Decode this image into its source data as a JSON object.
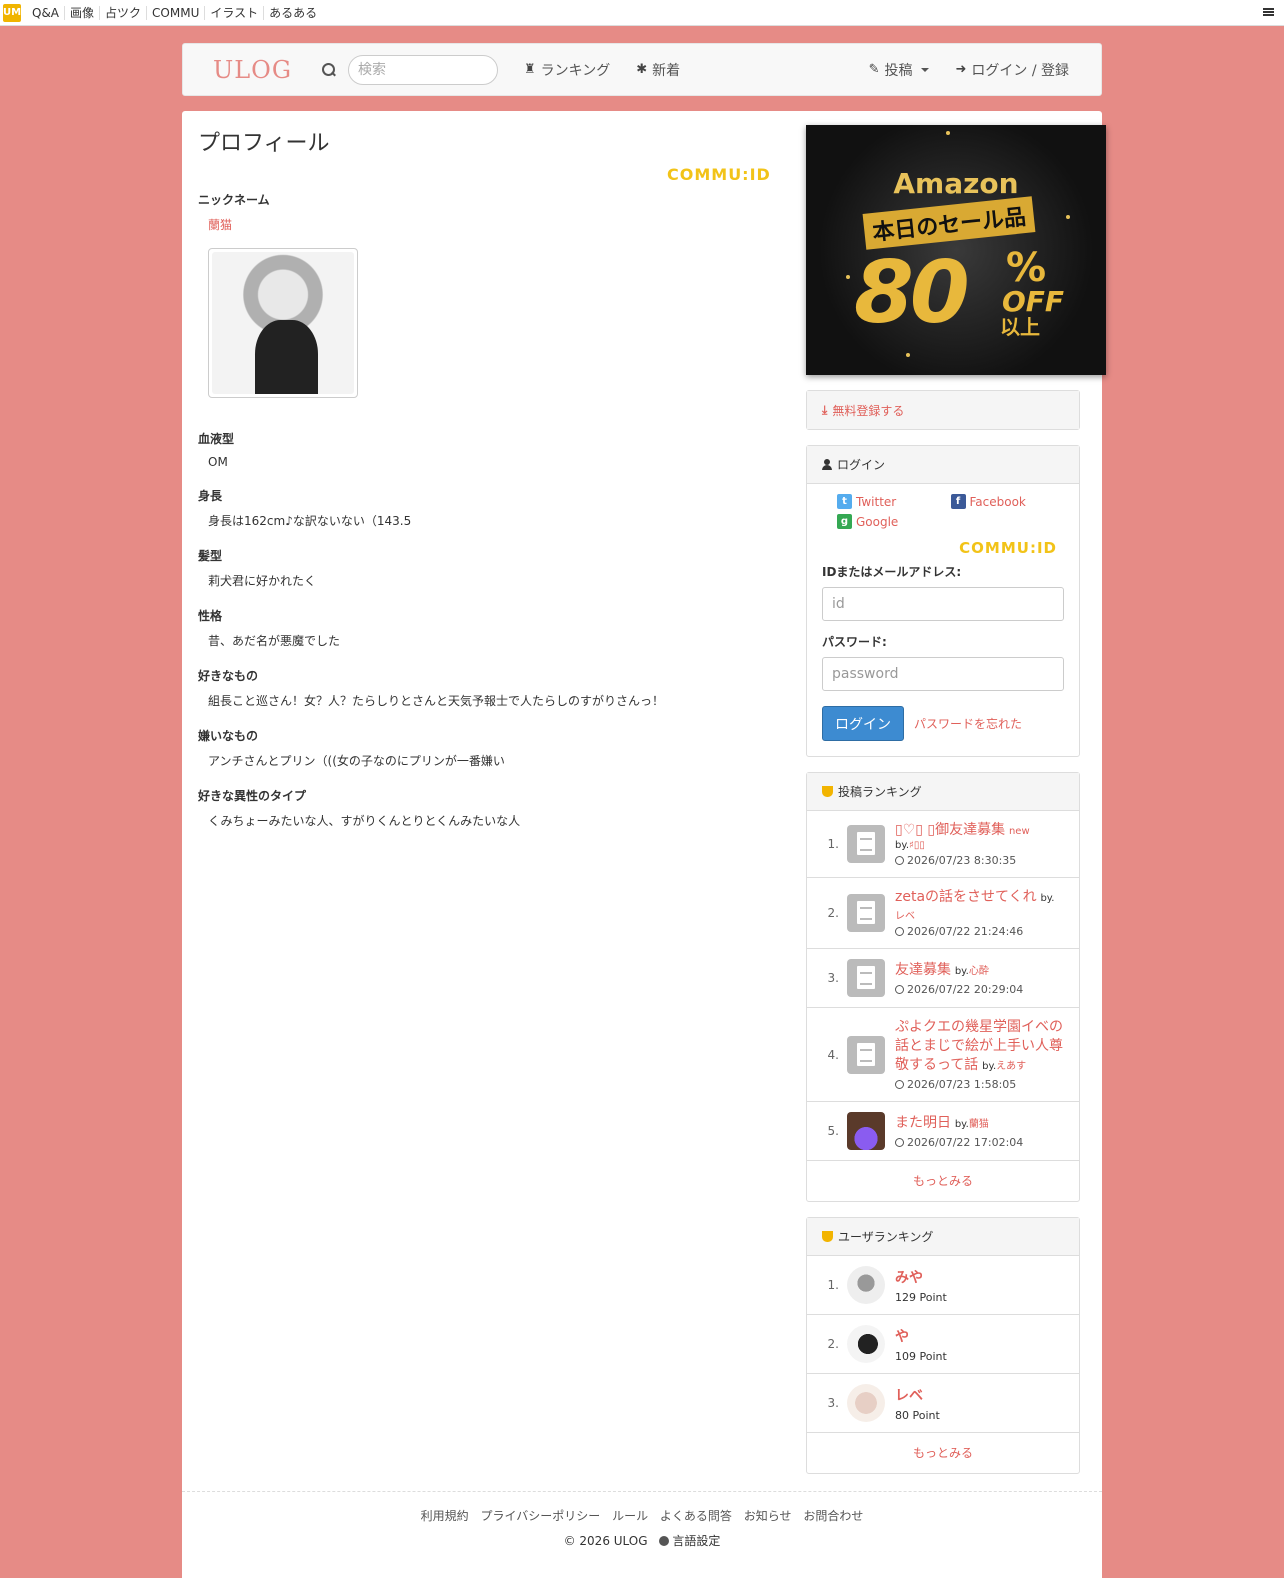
{
  "topbar": {
    "logo_text": "UM",
    "links": [
      "Q&A",
      "画像",
      "占ツク",
      "COMMU",
      "イラスト",
      "あるある"
    ]
  },
  "header": {
    "brand": "ULOG",
    "search_placeholder": "検索",
    "nav": {
      "ranking": "ランキング",
      "new": "新着",
      "post": "投稿",
      "login": "ログイン / 登録"
    }
  },
  "profile": {
    "title": "プロフィール",
    "commu_id": "COMMU:ID",
    "nickname_label": "ニックネーム",
    "nickname": "蘭猫",
    "fields": [
      {
        "label": "血液型",
        "value": "OM"
      },
      {
        "label": "身長",
        "value": "身長は162cm♪な訳ないない（143.5"
      },
      {
        "label": "髪型",
        "value": "莉犬君に好かれたく"
      },
      {
        "label": "性格",
        "value": "昔、あだ名が悪魔でした"
      },
      {
        "label": "好きなもの",
        "value": "組長こと巡さん！女？人？たらしりとさんと天気予報士で人たらしのすがりさんっ！"
      },
      {
        "label": "嫌いなもの",
        "value": "アンチさんとプリン（((女の子なのにプリンが一番嫌い"
      },
      {
        "label": "好きな異性のタイプ",
        "value": "くみちょーみたいな人、すがりくんとりとくんみたいな人"
      }
    ]
  },
  "ad": {
    "brand": "Amazon",
    "sub": "本日のセール品",
    "big": "80",
    "pct": "%",
    "off": "OFF",
    "ijo": "以上"
  },
  "register": {
    "label": "無料登録する"
  },
  "login_panel": {
    "heading": "ログイン",
    "twitter": "Twitter",
    "facebook": "Facebook",
    "google": "Google",
    "commu_id": "COMMU:ID",
    "id_label": "IDまたはメールアドレス:",
    "id_placeholder": "id",
    "pw_label": "パスワード:",
    "pw_placeholder": "password",
    "login_button": "ログイン",
    "forgot": "パスワードを忘れた"
  },
  "post_ranking": {
    "heading": "投稿ランキング",
    "by": "by.",
    "items": [
      {
        "num": "1.",
        "title": "▯♡▯ ▯御友達募集",
        "new": "new",
        "author": "♯▯▯",
        "time": "2026/07/23 8:30:35"
      },
      {
        "num": "2.",
        "title": "zetaの話をさせてくれ",
        "new": "",
        "author": "レベ",
        "time": "2026/07/22 21:24:46"
      },
      {
        "num": "3.",
        "title": "友達募集",
        "new": "",
        "author": "心酔",
        "time": "2026/07/22 20:29:04"
      },
      {
        "num": "4.",
        "title": "ぷよクエの幾星学園イベの話とまじで絵が上手い人尊敬するって話",
        "new": "",
        "author": "えあす",
        "time": "2026/07/23 1:58:05"
      },
      {
        "num": "5.",
        "title": "また明日",
        "new": "",
        "author": "蘭猫",
        "time": "2026/07/22 17:02:04"
      }
    ],
    "more": "もっとみる"
  },
  "user_ranking": {
    "heading": "ユーザランキング",
    "items": [
      {
        "num": "1.",
        "name": "みや",
        "points": "129 Point"
      },
      {
        "num": "2.",
        "name": "や",
        "points": "109 Point"
      },
      {
        "num": "3.",
        "name": "レベ",
        "points": "80 Point"
      }
    ],
    "more": "もっとみる"
  },
  "footer": {
    "links": [
      "利用規約",
      "プライバシーポリシー",
      "ルール",
      "よくある問答",
      "お知らせ",
      "お問合わせ"
    ],
    "copyright": "© 2026  ULOG",
    "language": "言語設定"
  }
}
